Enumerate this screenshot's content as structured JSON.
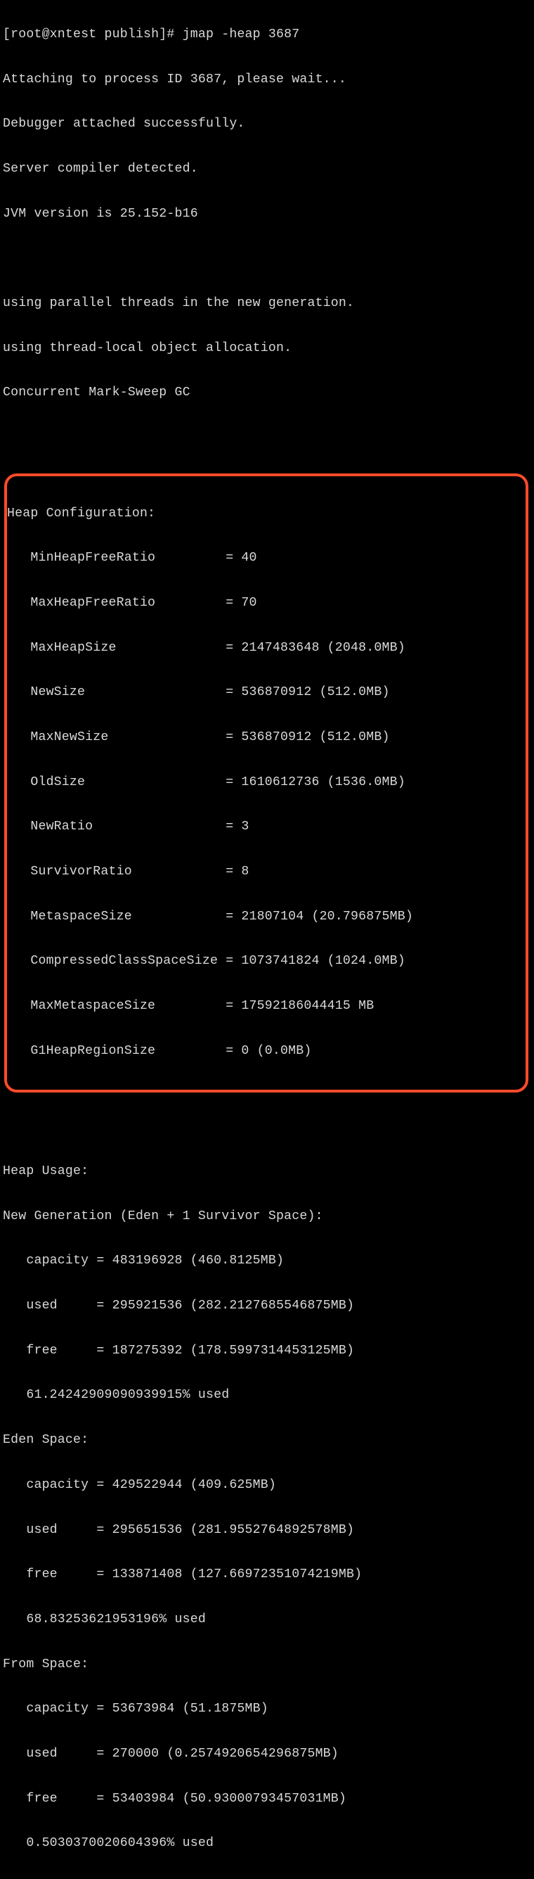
{
  "prompt": {
    "line": "[root@xntest publish]# jmap -heap 3687"
  },
  "preamble": {
    "l1": "Attaching to process ID 3687, please wait...",
    "l2": "Debugger attached successfully.",
    "l3": "Server compiler detected.",
    "l4": "JVM version is 25.152-b16",
    "blank1": "",
    "l5": "using parallel threads in the new generation.",
    "l6": "using thread-local object allocation.",
    "l7": "Concurrent Mark-Sweep GC"
  },
  "heap_config": {
    "title": "Heap Configuration:",
    "rows": [
      "   MinHeapFreeRatio         = 40",
      "   MaxHeapFreeRatio         = 70",
      "   MaxHeapSize              = 2147483648 (2048.0MB)",
      "   NewSize                  = 536870912 (512.0MB)",
      "   MaxNewSize               = 536870912 (512.0MB)",
      "   OldSize                  = 1610612736 (1536.0MB)",
      "   NewRatio                 = 3",
      "   SurvivorRatio            = 8",
      "   MetaspaceSize            = 21807104 (20.796875MB)",
      "   CompressedClassSpaceSize = 1073741824 (1024.0MB)",
      "   MaxMetaspaceSize         = 17592186044415 MB",
      "   G1HeapRegionSize         = 0 (0.0MB)"
    ]
  },
  "heap_usage": {
    "title": "Heap Usage:",
    "new_gen": {
      "title": "New Generation (Eden + 1 Survivor Space):",
      "capacity": "   capacity = 483196928 (460.8125MB)",
      "used": "   used     = 295921536 (282.2127685546875MB)",
      "free": "   free     = 187275392 (178.5997314453125MB)",
      "pct": "   61.24242909090939915% used"
    },
    "eden": {
      "title": "Eden Space:",
      "capacity": "   capacity = 429522944 (409.625MB)",
      "used": "   used     = 295651536 (281.9552764892578MB)",
      "free": "   free     = 133871408 (127.66972351074219MB)",
      "pct": "   68.83253621953196% used"
    },
    "from": {
      "title": "From Space:",
      "capacity": "   capacity = 53673984 (51.1875MB)",
      "used": "   used     = 270000 (0.2574920654296875MB)",
      "free": "   free     = 53403984 (50.93000793457031MB)",
      "pct": "   0.5030370020604396% used"
    }
  }
}
